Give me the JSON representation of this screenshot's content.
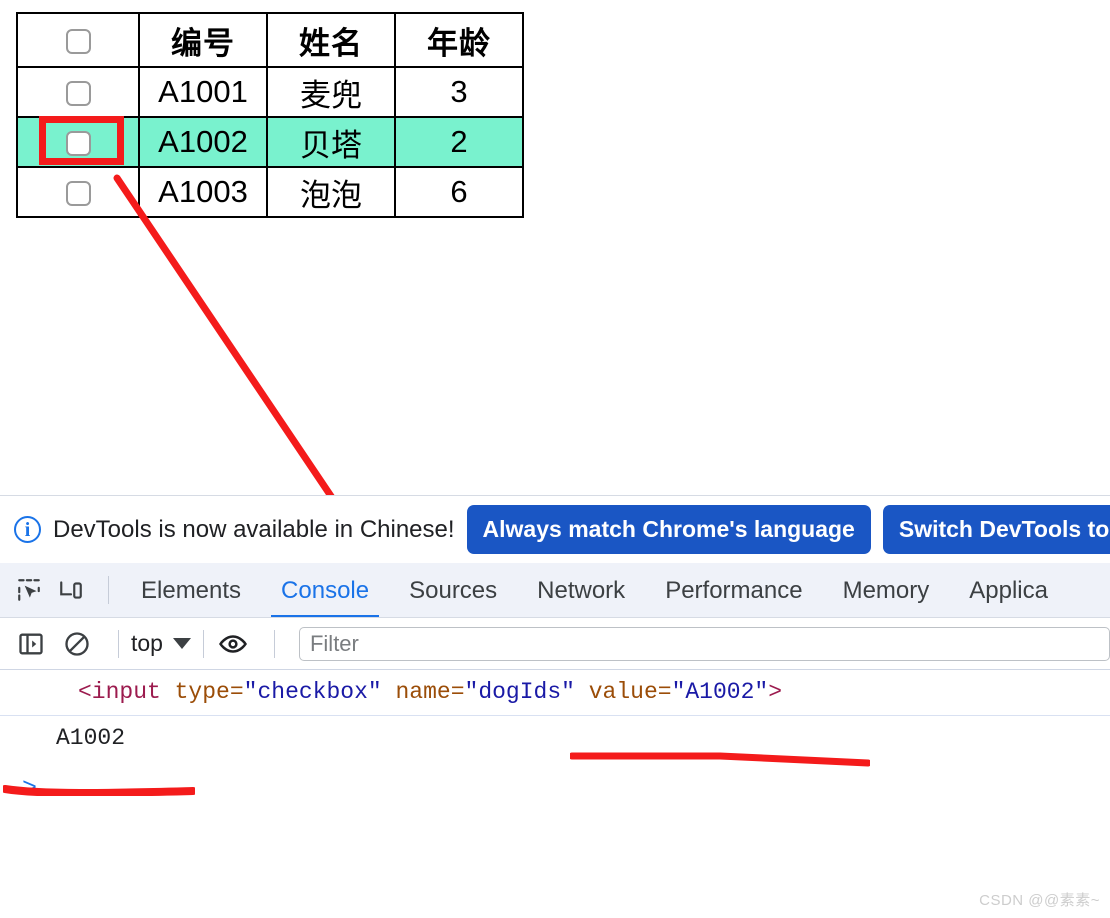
{
  "page": {
    "table": {
      "headers": [
        "",
        "编号",
        "姓名",
        "年龄"
      ],
      "rows": [
        {
          "checkbox": "unchecked",
          "id": "A1001",
          "name": "麦兜",
          "age": "3",
          "highlighted": false
        },
        {
          "checkbox": "unchecked",
          "id": "A1002",
          "name": "贝塔",
          "age": "2",
          "highlighted": true
        },
        {
          "checkbox": "unchecked",
          "id": "A1003",
          "name": "泡泡",
          "age": "6",
          "highlighted": false
        }
      ]
    },
    "annotations": {
      "highlight_color": "#79f2ce",
      "marker_color": "#f41b1b",
      "box_target": "A1002 row checkbox",
      "arrow_from": "A1002 row checkbox",
      "arrow_to": "console output"
    }
  },
  "devtools": {
    "banner": {
      "icon": "info-icon",
      "message": "DevTools is now available in Chinese!",
      "buttons": [
        "Always match Chrome's language",
        "Switch DevTools to C"
      ],
      "button_color": "#1a56c4"
    },
    "tabs": {
      "icons": [
        "inspect-element-icon",
        "device-toolbar-icon"
      ],
      "items": [
        {
          "label": "Elements",
          "active": false
        },
        {
          "label": "Console",
          "active": true
        },
        {
          "label": "Sources",
          "active": false
        },
        {
          "label": "Network",
          "active": false
        },
        {
          "label": "Performance",
          "active": false
        },
        {
          "label": "Memory",
          "active": false
        },
        {
          "label": "Applica",
          "active": false
        }
      ],
      "active_color": "#1a73e8"
    },
    "toolbar": {
      "sidebar_icon": "console-sidebar-icon",
      "clear_icon": "clear-console-icon",
      "context": "top",
      "eye_icon": "live-expression-icon",
      "filter_placeholder": "Filter",
      "filter_value": ""
    },
    "console": {
      "entry": {
        "tag_open": "<input",
        "attr1_name": " type=",
        "attr1_value": "\"checkbox\"",
        "attr2_name": " name=",
        "attr2_value": "\"dogIds\"",
        "attr3_name": " value=",
        "attr3_value": "\"A1002\"",
        "tag_close": ">"
      },
      "result": "A1002",
      "prompt": ">"
    }
  },
  "watermark": "CSDN @@素素~"
}
